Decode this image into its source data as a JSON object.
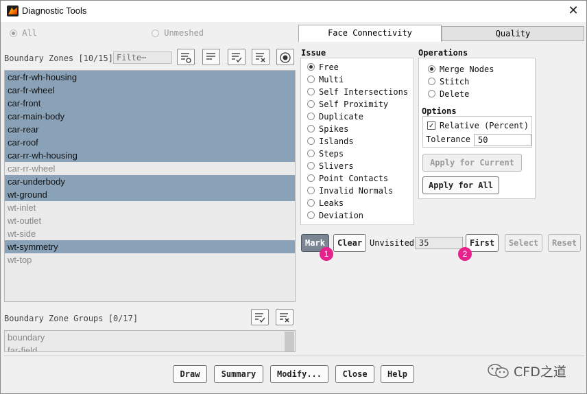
{
  "window": {
    "title": "Diagnostic Tools"
  },
  "filter_mode": {
    "options": [
      {
        "label": "All",
        "selected": true
      },
      {
        "label": "Unmeshed",
        "selected": false
      }
    ]
  },
  "boundary_zones": {
    "header": "Boundary Zones [10/15]",
    "filter_placeholder": "Filte⋯",
    "items": [
      {
        "label": "car-fr-wh-housing",
        "selected": true
      },
      {
        "label": "car-fr-wheel",
        "selected": true
      },
      {
        "label": "car-front",
        "selected": true
      },
      {
        "label": "car-main-body",
        "selected": true
      },
      {
        "label": "car-rear",
        "selected": true
      },
      {
        "label": "car-roof",
        "selected": true
      },
      {
        "label": "car-rr-wh-housing",
        "selected": true
      },
      {
        "label": "car-rr-wheel",
        "selected": false
      },
      {
        "label": "car-underbody",
        "selected": true
      },
      {
        "label": "wt-ground",
        "selected": true
      },
      {
        "label": "wt-inlet",
        "selected": false
      },
      {
        "label": "wt-outlet",
        "selected": false
      },
      {
        "label": "wt-side",
        "selected": false
      },
      {
        "label": "wt-symmetry",
        "selected": true
      },
      {
        "label": "wt-top",
        "selected": false
      }
    ]
  },
  "zone_groups": {
    "header": "Boundary Zone Groups [0/17]",
    "items": [
      {
        "label": "boundary"
      },
      {
        "label": "far-field"
      }
    ]
  },
  "tabs": [
    {
      "label": "Face Connectivity",
      "active": true
    },
    {
      "label": "Quality",
      "active": false
    }
  ],
  "issue": {
    "heading": "Issue",
    "options": [
      {
        "label": "Free",
        "selected": true
      },
      {
        "label": "Multi",
        "selected": false
      },
      {
        "label": "Self Intersections",
        "selected": false
      },
      {
        "label": "Self Proximity",
        "selected": false
      },
      {
        "label": "Duplicate",
        "selected": false
      },
      {
        "label": "Spikes",
        "selected": false
      },
      {
        "label": "Islands",
        "selected": false
      },
      {
        "label": "Steps",
        "selected": false
      },
      {
        "label": "Slivers",
        "selected": false
      },
      {
        "label": "Point Contacts",
        "selected": false
      },
      {
        "label": "Invalid Normals",
        "selected": false
      },
      {
        "label": "Leaks",
        "selected": false
      },
      {
        "label": "Deviation",
        "selected": false
      }
    ]
  },
  "operations": {
    "heading": "Operations",
    "options": [
      {
        "label": "Merge Nodes",
        "selected": true
      },
      {
        "label": "Stitch",
        "selected": false
      },
      {
        "label": "Delete",
        "selected": false
      }
    ],
    "options_heading": "Options",
    "relative_label": "Relative (Percent)",
    "relative_checked": true,
    "tolerance_label": "Tolerance",
    "tolerance_value": "50",
    "apply_current_label": "Apply for Current",
    "apply_all_label": "Apply for All"
  },
  "mark_row": {
    "mark_label": "Mark",
    "clear_label": "Clear",
    "unvisited_label": "Unvisited",
    "unvisited_value": "35",
    "first_label": "First",
    "select_label": "Select",
    "reset_label": "Reset"
  },
  "badges": [
    "1",
    "2"
  ],
  "footer": {
    "buttons": [
      "Draw",
      "Summary",
      "Modify...",
      "Close",
      "Help"
    ],
    "watermark": "CFD之道"
  },
  "colors": {
    "selected_row": "#8aa2b8",
    "badge": "#e6218c",
    "mark_button": "#7b8593"
  }
}
